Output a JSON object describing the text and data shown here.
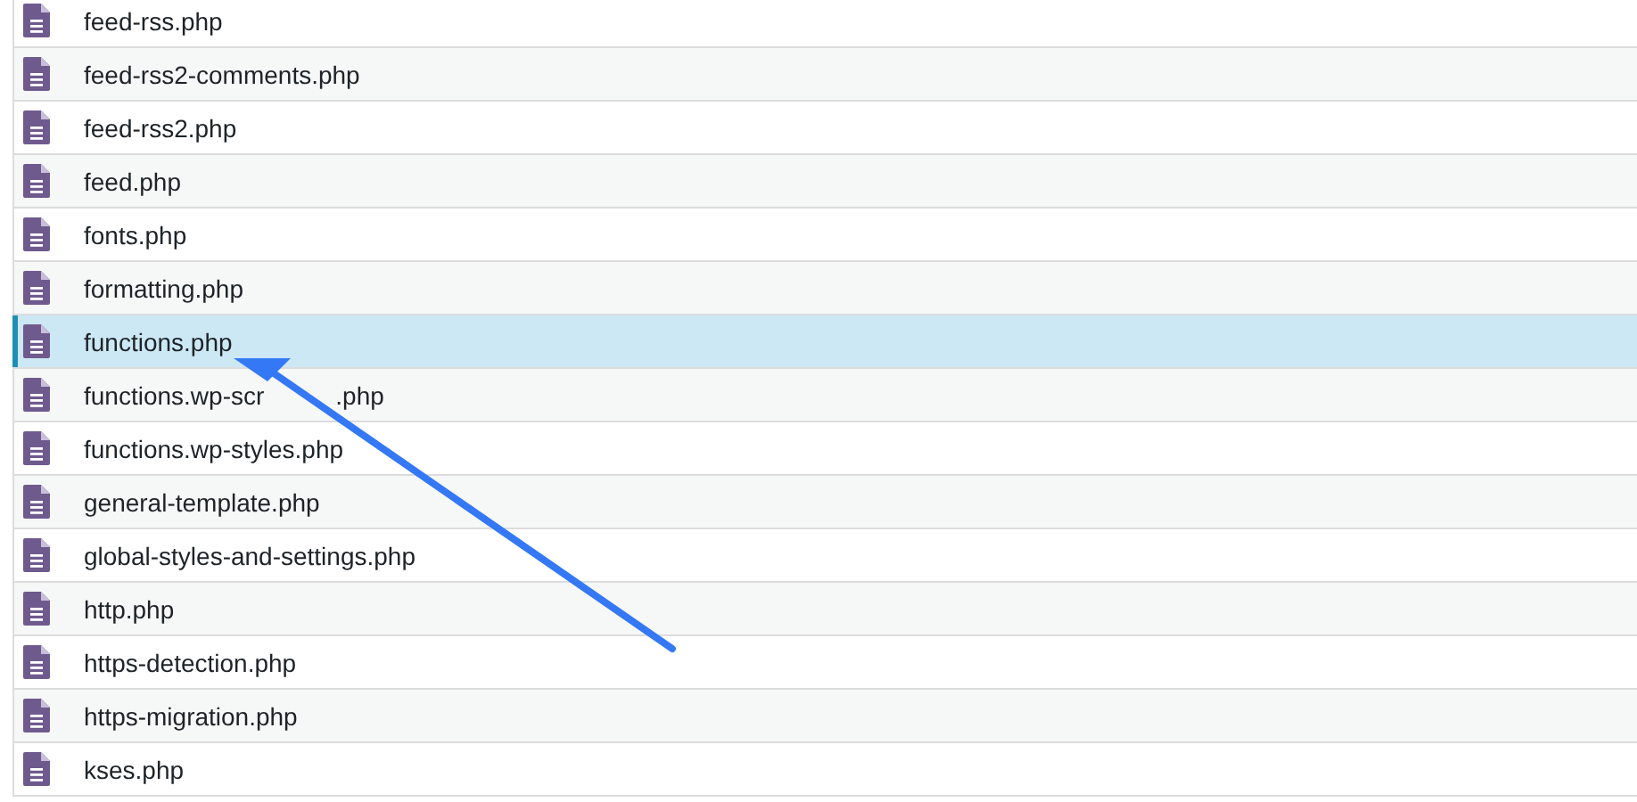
{
  "files": [
    {
      "name": "feed-rss.php",
      "selected": false
    },
    {
      "name": "feed-rss2-comments.php",
      "selected": false
    },
    {
      "name": "feed-rss2.php",
      "selected": false
    },
    {
      "name": "feed.php",
      "selected": false
    },
    {
      "name": "fonts.php",
      "selected": false
    },
    {
      "name": "formatting.php",
      "selected": false
    },
    {
      "name": "functions.php",
      "selected": true
    },
    {
      "name": "functions.wp-scr",
      "name_end": ".php",
      "selected": false
    },
    {
      "name": "functions.wp-styles.php",
      "selected": false
    },
    {
      "name": "general-template.php",
      "selected": false
    },
    {
      "name": "global-styles-and-settings.php",
      "selected": false
    },
    {
      "name": "http.php",
      "selected": false
    },
    {
      "name": "https-detection.php",
      "selected": false
    },
    {
      "name": "https-migration.php",
      "selected": false
    },
    {
      "name": "kses.php",
      "selected": false
    }
  ]
}
